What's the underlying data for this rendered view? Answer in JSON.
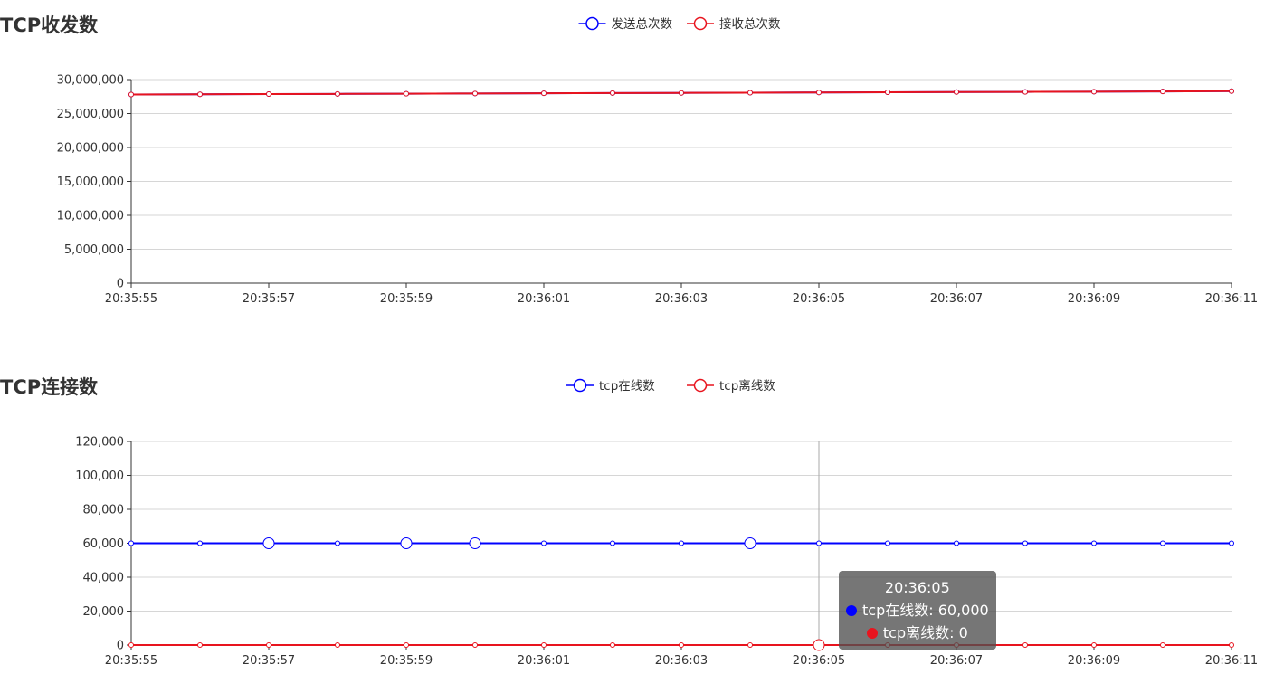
{
  "chart_data": [
    {
      "type": "line",
      "title": "TCP收发数",
      "x": [
        "20:35:55",
        "20:35:56",
        "20:35:57",
        "20:35:58",
        "20:35:59",
        "20:36:00",
        "20:36:01",
        "20:36:02",
        "20:36:03",
        "20:36:04",
        "20:36:05",
        "20:36:06",
        "20:36:07",
        "20:36:08",
        "20:36:09",
        "20:36:10",
        "20:36:11"
      ],
      "x_tick_labels": [
        "20:35:55",
        "20:35:57",
        "20:35:59",
        "20:36:01",
        "20:36:03",
        "20:36:05",
        "20:36:07",
        "20:36:09",
        "20:36:11"
      ],
      "y_tick_labels": [
        "0",
        "5,000,000",
        "10,000,000",
        "15,000,000",
        "20,000,000",
        "25,000,000",
        "30,000,000"
      ],
      "ylim": [
        0,
        30000000
      ],
      "grid": true,
      "legend_position": "top-center",
      "series": [
        {
          "name": "发送总次数",
          "color": "#0000ff",
          "values": [
            27800000,
            27830000,
            27860000,
            27890000,
            27920000,
            27950000,
            27980000,
            28010000,
            28040000,
            28070000,
            28100000,
            28130000,
            28160000,
            28190000,
            28220000,
            28250000,
            28300000
          ]
        },
        {
          "name": "接收总次数",
          "color": "#e8141e",
          "values": [
            27800000,
            27830000,
            27860000,
            27890000,
            27920000,
            27950000,
            27980000,
            28010000,
            28040000,
            28070000,
            28100000,
            28130000,
            28160000,
            28190000,
            28220000,
            28250000,
            28300000
          ]
        }
      ]
    },
    {
      "type": "line",
      "title": "TCP连接数",
      "x": [
        "20:35:55",
        "20:35:56",
        "20:35:57",
        "20:35:58",
        "20:35:59",
        "20:36:00",
        "20:36:01",
        "20:36:02",
        "20:36:03",
        "20:36:04",
        "20:36:05",
        "20:36:06",
        "20:36:07",
        "20:36:08",
        "20:36:09",
        "20:36:10",
        "20:36:11"
      ],
      "x_tick_labels": [
        "20:35:55",
        "20:35:57",
        "20:35:59",
        "20:36:01",
        "20:36:03",
        "20:36:05",
        "20:36:07",
        "20:36:09",
        "20:36:11"
      ],
      "y_tick_labels": [
        "0",
        "20,000",
        "40,000",
        "60,000",
        "80,000",
        "100,000",
        "120,000"
      ],
      "ylim": [
        0,
        120000
      ],
      "grid": true,
      "legend_position": "top-center",
      "series": [
        {
          "name": "tcp在线数",
          "color": "#0000ff",
          "values": [
            60000,
            60000,
            60000,
            60000,
            60000,
            60000,
            60000,
            60000,
            60000,
            60000,
            60000,
            60000,
            60000,
            60000,
            60000,
            60000,
            60000
          ]
        },
        {
          "name": "tcp离线数",
          "color": "#e8141e",
          "values": [
            0,
            0,
            0,
            0,
            0,
            0,
            0,
            0,
            0,
            0,
            0,
            0,
            0,
            0,
            0,
            0,
            0
          ]
        }
      ],
      "highlighted_index": 10,
      "tooltip": {
        "title": "20:36:05",
        "rows": [
          {
            "text": "tcp在线数: 60,000",
            "color": "#0000ff"
          },
          {
            "text": "tcp离线数: 0",
            "color": "#e8141e"
          }
        ]
      }
    }
  ]
}
